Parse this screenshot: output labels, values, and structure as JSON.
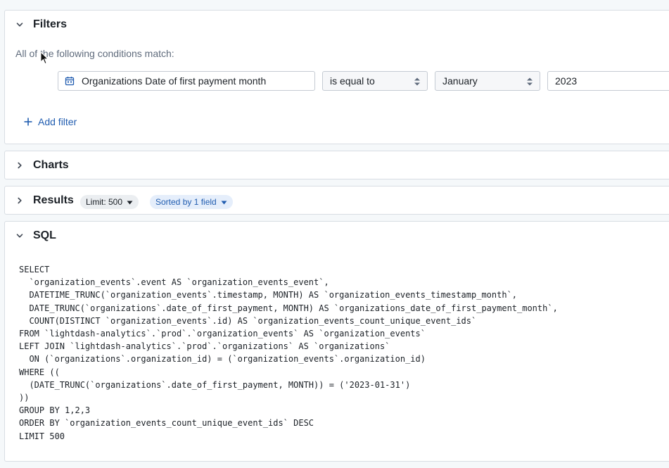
{
  "filters": {
    "title": "Filters",
    "conditions_label": "All of the following conditions match:",
    "rule": {
      "dimension": "Organizations Date of first payment month",
      "operator": "is equal to",
      "month": "January",
      "year": "2023"
    },
    "add_filter_label": "Add filter"
  },
  "charts": {
    "title": "Charts"
  },
  "results": {
    "title": "Results",
    "limit_tag": "Limit: 500",
    "sort_tag": "Sorted by 1 field"
  },
  "sql": {
    "title": "SQL",
    "query": "SELECT\n  `organization_events`.event AS `organization_events_event`,\n  DATETIME_TRUNC(`organization_events`.timestamp, MONTH) AS `organization_events_timestamp_month`,\n  DATE_TRUNC(`organizations`.date_of_first_payment, MONTH) AS `organizations_date_of_first_payment_month`,\n  COUNT(DISTINCT `organization_events`.id) AS `organization_events_count_unique_event_ids`\nFROM `lightdash-analytics`.`prod`.`organization_events` AS `organization_events`\nLEFT JOIN `lightdash-analytics`.`prod`.`organizations` AS `organizations`\n  ON (`organizations`.organization_id) = (`organization_events`.organization_id)\nWHERE ((\n  (DATE_TRUNC(`organizations`.date_of_first_payment, MONTH)) = ('2023-01-31')\n))\nGROUP BY 1,2,3\nORDER BY `organization_events_count_unique_event_ids` DESC\nLIMIT 500"
  },
  "icons": {
    "expanded": "chevron-down-icon",
    "collapsed": "chevron-right-icon",
    "calendar": "calendar-icon",
    "select": "double-caret-icon",
    "add": "plus-icon",
    "dropdown": "caret-down-icon"
  },
  "colors": {
    "accent": "#215db0",
    "muted_text": "#5f6b7c",
    "border": "#d8dde3",
    "background": "#f5f8fa"
  }
}
